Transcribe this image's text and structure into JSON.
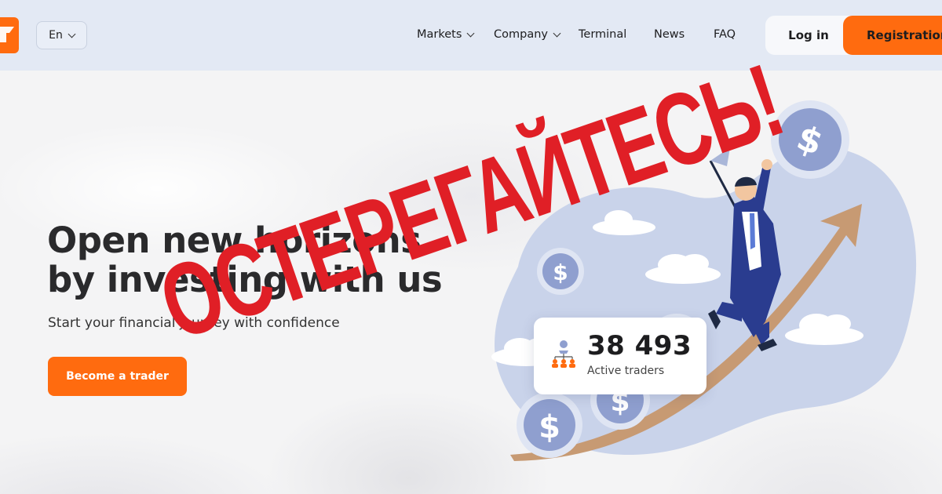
{
  "header": {
    "language": "En",
    "nav": [
      {
        "label": "Markets",
        "dropdown": true
      },
      {
        "label": "Company",
        "dropdown": true
      },
      {
        "label": "Terminal",
        "dropdown": false
      },
      {
        "label": "News",
        "dropdown": false
      },
      {
        "label": "FAQ",
        "dropdown": false
      }
    ],
    "login_label": "Log in",
    "register_label": "Registration"
  },
  "hero": {
    "title_line1": "Open new horizons",
    "title_line2": "by investing with us",
    "subtitle": "Start your financial journey with confidence",
    "cta_label": "Become a trader"
  },
  "stats": {
    "active_traders_value": "38 493",
    "active_traders_label": "Active traders"
  },
  "overlay": {
    "warning_text": "ОСТЕРЕГАЙТЕСЬ!"
  },
  "colors": {
    "brand_orange": "#ff6b0f",
    "header_bg": "#e3e9f4",
    "illustration_blue": "#c9d3ea",
    "coin_blue": "#8f9fcf",
    "arrow_tan": "#c79a73",
    "warning_red": "#e01f26"
  },
  "icons": [
    "logo-icon",
    "chevron-down-icon",
    "network-people-icon",
    "dollar-coin-icon",
    "rocket-arrow-icon",
    "businessman-illustration"
  ]
}
